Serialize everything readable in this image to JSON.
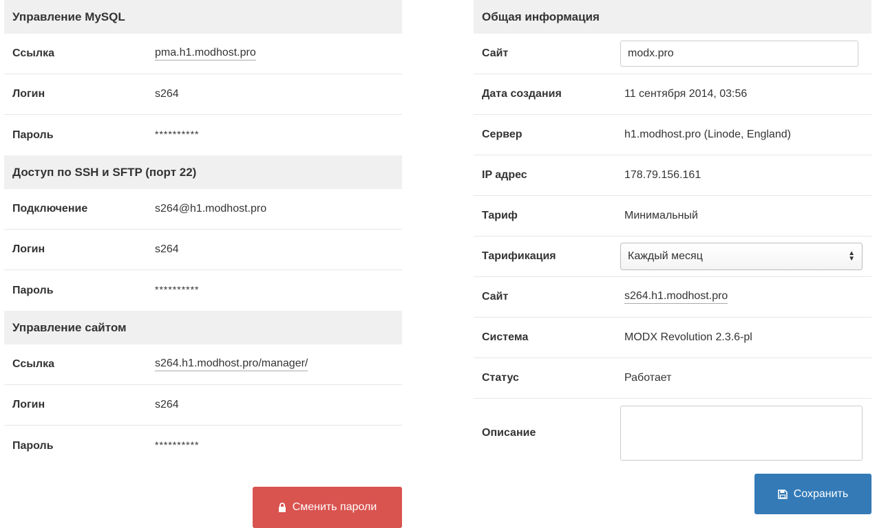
{
  "mysql": {
    "title": "Управление MySQL",
    "link_label": "Ссылка",
    "link_value": "pma.h1.modhost.pro",
    "login_label": "Логин",
    "login_value": "s264",
    "password_label": "Пароль",
    "password_value": "**********"
  },
  "ssh": {
    "title": "Доступ по SSH и SFTP (порт 22)",
    "connection_label": "Подключение",
    "connection_value": "s264@h1.modhost.pro",
    "login_label": "Логин",
    "login_value": "s264",
    "password_label": "Пароль",
    "password_value": "**********"
  },
  "site_manager": {
    "title": "Управление сайтом",
    "link_label": "Ссылка",
    "link_value": "s264.h1.modhost.pro/manager/",
    "login_label": "Логин",
    "login_value": "s264",
    "password_label": "Пароль",
    "password_value": "**********"
  },
  "change_passwords_button": {
    "label": "Сменить пароли",
    "icon": "lock-icon"
  },
  "general": {
    "title": "Общая информация",
    "site_label": "Сайт",
    "site_input_value": "modx.pro",
    "created_label": "Дата создания",
    "created_value": "11 сентября 2014, 03:56",
    "server_label": "Сервер",
    "server_value": "h1.modhost.pro (Linode, England)",
    "ip_label": "IP адрес",
    "ip_value": "178.79.156.161",
    "tariff_label": "Тариф",
    "tariff_value": "Минимальный",
    "billing_label": "Тарификация",
    "billing_selected": "Каждый месяц",
    "site2_label": "Сайт",
    "site2_value": "s264.h1.modhost.pro",
    "system_label": "Система",
    "system_value": "MODX Revolution 2.3.6-pl",
    "status_label": "Статус",
    "status_value": "Работает",
    "description_label": "Описание",
    "description_value": ""
  },
  "save_button": {
    "label": "Сохранить",
    "icon": "save-icon"
  },
  "colors": {
    "header_bg": "#f0f0f0",
    "danger": "#d9534f",
    "primary": "#337ab7",
    "status_ok": "#1a7d1a"
  }
}
